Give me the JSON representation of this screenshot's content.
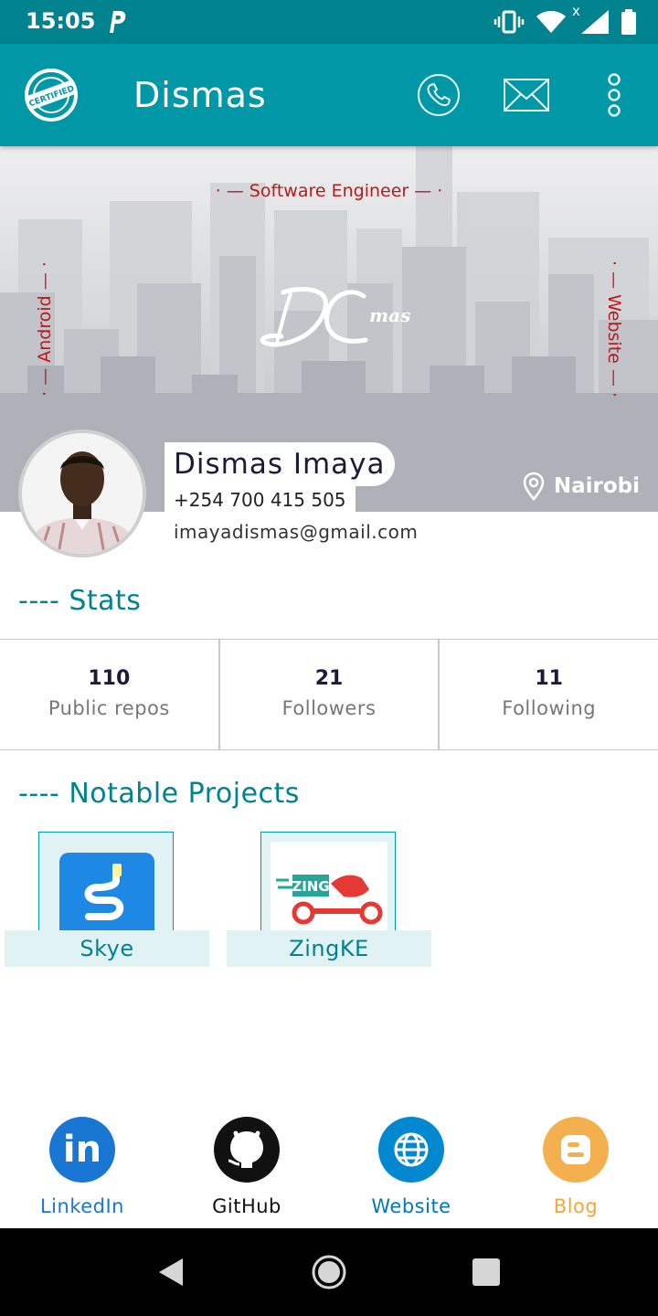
{
  "status_bar": {
    "time": "15:05",
    "icons": [
      "parking-icon",
      "vibrate-icon",
      "wifi-icon",
      "signal-icon",
      "battery-icon"
    ],
    "signal_mark": "x"
  },
  "app_bar": {
    "logo_text": "CERTIFIED",
    "title": "Dismas",
    "actions": [
      "phone-icon",
      "mail-icon",
      "more-icon"
    ],
    "background": "#0097a7"
  },
  "banner": {
    "top_label": "· — Software Engineer — ·",
    "left_label": "· — Android — ·",
    "right_label": "· — Website — ·",
    "logo": {
      "initials": "DC",
      "suffix": "mas"
    },
    "location": "Nairobi"
  },
  "profile": {
    "name": "Dismas Imaya",
    "phone": "+254 700 415 505",
    "email": "imayadismas@gmail.com"
  },
  "stats": {
    "title": "---- Stats",
    "items": [
      {
        "value": "110",
        "label": "Public repos"
      },
      {
        "value": "21",
        "label": "Followers"
      },
      {
        "value": "11",
        "label": "Following"
      }
    ]
  },
  "projects": {
    "title": "---- Notable Projects",
    "items": [
      {
        "name": "Skye",
        "icon": "skye-app-icon"
      },
      {
        "name": "ZingKE",
        "icon": "zing-app-icon",
        "logo_text": "ZING"
      }
    ]
  },
  "social": [
    {
      "label": "LinkedIn",
      "icon": "linkedin-icon",
      "color": "#1976d2",
      "label_color": "#1976d2",
      "glyph": "in"
    },
    {
      "label": "GitHub",
      "icon": "github-icon",
      "color": "#111111",
      "label_color": "#111111"
    },
    {
      "label": "Website",
      "icon": "globe-icon",
      "color": "#0288d1",
      "label_color": "#0277bd"
    },
    {
      "label": "Blog",
      "icon": "blogger-icon",
      "color": "#f4b04f",
      "label_color": "#f0a83c"
    }
  ],
  "nav_bar": [
    "back-icon",
    "home-icon",
    "recents-icon"
  ],
  "colors": {
    "accent": "#00838f",
    "banner_text": "#b71c1c"
  }
}
